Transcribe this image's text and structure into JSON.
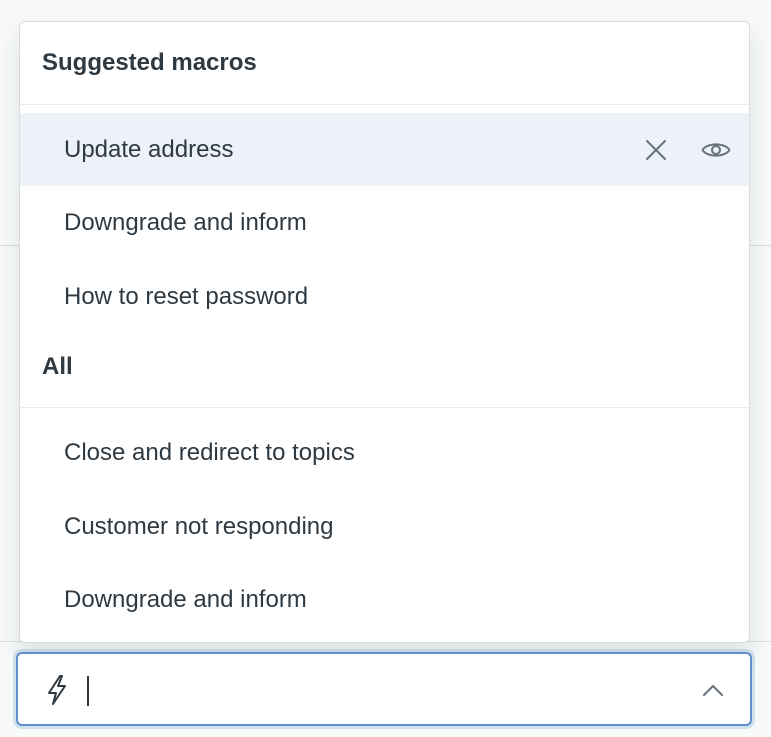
{
  "menu": {
    "groups": [
      {
        "header": "Suggested macros",
        "items": [
          {
            "label": "Update address",
            "active": true
          },
          {
            "label": "Downgrade and inform"
          },
          {
            "label": "How to reset password"
          }
        ]
      },
      {
        "header": "All",
        "items": [
          {
            "label": "Close and redirect to topics"
          },
          {
            "label": "Customer not responding"
          },
          {
            "label": "Downgrade and inform"
          }
        ]
      }
    ],
    "active_item_actions": [
      "close-icon",
      "eye-icon"
    ]
  },
  "combobox": {
    "value": "",
    "leading_icon": "lightning-bolt-icon",
    "trailing_icon": "chevron-up-icon"
  },
  "colors": {
    "active_row": "#edf2f9",
    "focus_border": "#5f8fcf",
    "text": "#2f3941",
    "icon": "#68737d"
  }
}
